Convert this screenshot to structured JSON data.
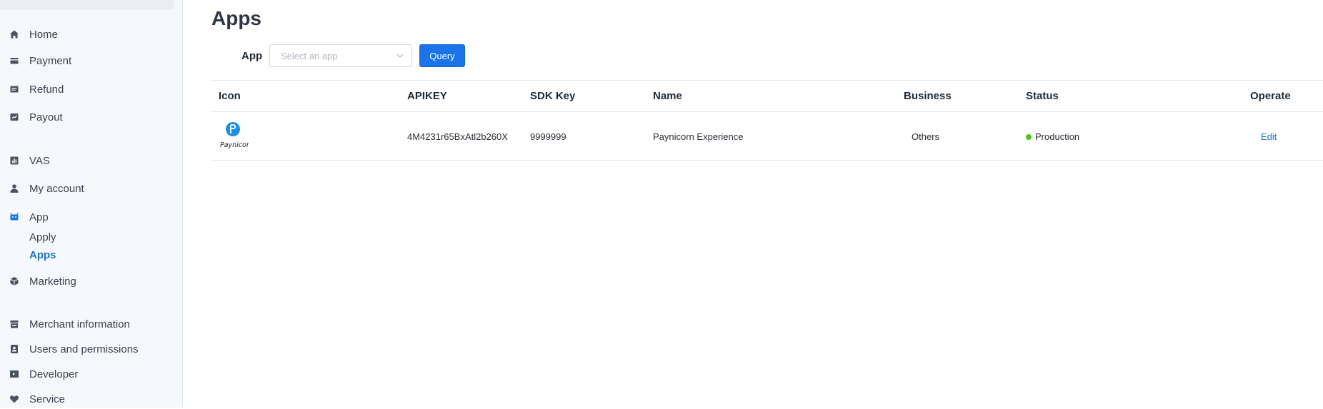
{
  "sidebar": {
    "items": [
      {
        "label": "Home",
        "icon": "home-icon"
      },
      {
        "label": "Payment",
        "icon": "payment-icon"
      },
      {
        "label": "Refund",
        "icon": "refund-icon"
      },
      {
        "label": "Payout",
        "icon": "payout-icon"
      },
      {
        "label": "VAS",
        "icon": "chart-icon"
      },
      {
        "label": "My account",
        "icon": "user-icon"
      },
      {
        "label": "App",
        "icon": "app-icon"
      },
      {
        "label": "Marketing",
        "icon": "box-icon"
      },
      {
        "label": "Merchant information",
        "icon": "store-icon"
      },
      {
        "label": "Users and permissions",
        "icon": "contacts-icon"
      },
      {
        "label": "Developer",
        "icon": "terminal-icon"
      },
      {
        "label": "Service",
        "icon": "heart-icon"
      }
    ],
    "app_sub": [
      {
        "label": "Apply"
      },
      {
        "label": "Apps"
      }
    ]
  },
  "page": {
    "title": "Apps"
  },
  "filter": {
    "label": "App",
    "placeholder": "Select an app",
    "query_label": "Query"
  },
  "table": {
    "headers": {
      "icon": "Icon",
      "apikey": "APIKEY",
      "sdk_key": "SDK Key",
      "name": "Name",
      "business": "Business",
      "status": "Status",
      "operate": "Operate"
    },
    "rows": [
      {
        "logo_text": "Paynicorn",
        "apikey": "4M4231r65BxAtl2b260X",
        "sdk_key": "9999999",
        "name": "Paynicorn Experience",
        "business": "Others",
        "status": "Production",
        "operate": "Edit"
      }
    ]
  },
  "colors": {
    "accent": "#1a73e8",
    "link": "#1a73c9",
    "status_production": "#52c41a",
    "sidebar_bg": "#f5f9fd"
  }
}
